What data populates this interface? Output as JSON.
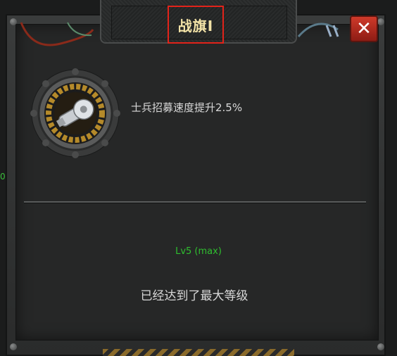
{
  "dialog": {
    "title": "战旗I",
    "close_label": "✕",
    "side_value": "0"
  },
  "buff": {
    "icon": "whistle-icon",
    "effect": "士兵招募速度提升2.5%"
  },
  "status": {
    "level": "Lv5 (max)",
    "max_message": "已经达到了最大等级"
  },
  "colors": {
    "title": "#f2e2a6",
    "level": "#2fbf2f",
    "close": "#cf3a2a",
    "highlight_box": "#e2231a"
  }
}
